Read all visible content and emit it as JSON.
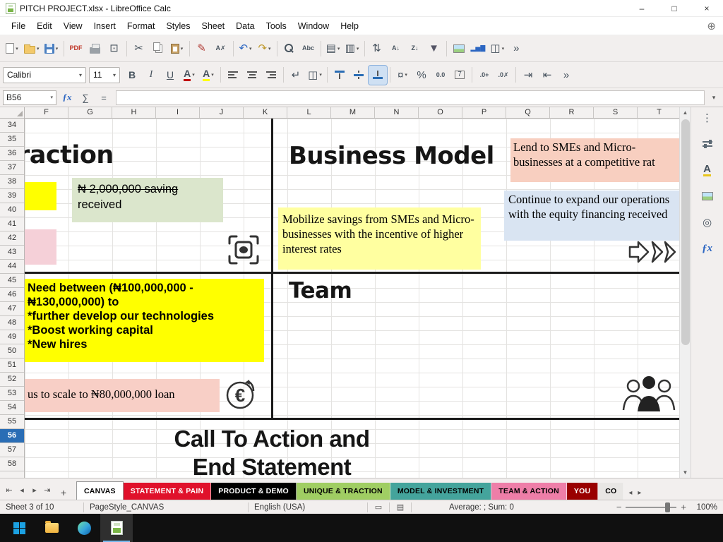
{
  "window": {
    "title": "PITCH PROJECT.xlsx - LibreOffice Calc",
    "minimize_glyph": "–",
    "maximize_glyph": "□",
    "close_glyph": "×"
  },
  "menu": {
    "items": [
      "File",
      "Edit",
      "View",
      "Insert",
      "Format",
      "Styles",
      "Sheet",
      "Data",
      "Tools",
      "Window",
      "Help"
    ],
    "right_icon_glyph": "⊕"
  },
  "toolbar_main": {
    "items": [
      {
        "name": "new-document",
        "icon": "doc",
        "dropdown": true
      },
      {
        "name": "open-file",
        "icon": "folder",
        "dropdown": true
      },
      {
        "name": "save",
        "icon": "save",
        "dropdown": true
      },
      {
        "sep": true
      },
      {
        "name": "export-pdf",
        "glyph": "PDF",
        "cls": "tiny red"
      },
      {
        "name": "print",
        "icon": "printer"
      },
      {
        "name": "print-preview",
        "glyph": "⊡"
      },
      {
        "sep": true
      },
      {
        "name": "cut",
        "glyph": "✂"
      },
      {
        "name": "copy",
        "icon": "copy"
      },
      {
        "name": "paste",
        "icon": "paste",
        "dropdown": true
      },
      {
        "sep": true
      },
      {
        "name": "clone-formatting",
        "glyph": "✎",
        "color": "#b3403a"
      },
      {
        "name": "clear-formatting",
        "glyph": "A✗",
        "cls": "tiny"
      },
      {
        "sep": true
      },
      {
        "name": "undo",
        "glyph": "↶",
        "color": "#2c66c2",
        "dropdown": true
      },
      {
        "name": "redo",
        "glyph": "↷",
        "color": "#c09a2f",
        "dropdown": true
      },
      {
        "sep": true
      },
      {
        "name": "find-and-replace",
        "icon": "magnifier"
      },
      {
        "name": "spelling",
        "glyph": "Abc",
        "cls": "tiny"
      },
      {
        "sep": true
      },
      {
        "name": "insert-rows",
        "glyph": "▤",
        "dropdown": true
      },
      {
        "name": "insert-columns",
        "glyph": "▥",
        "dropdown": true
      },
      {
        "sep": true
      },
      {
        "name": "sort",
        "glyph": "⇅"
      },
      {
        "name": "sort-ascending",
        "glyph": "A↓",
        "cls": "tiny"
      },
      {
        "name": "sort-descending",
        "glyph": "Z↓",
        "cls": "tiny"
      },
      {
        "name": "autofilter",
        "glyph": "▼",
        "color": "#556"
      },
      {
        "sep": true
      },
      {
        "name": "insert-image",
        "icon": "image"
      },
      {
        "name": "insert-chart",
        "glyph": "▂▅▇",
        "color": "#2c66c2",
        "cls": "tiny"
      },
      {
        "name": "freeze-rows-and-columns",
        "glyph": "◫",
        "dropdown": true
      },
      {
        "name": "toolbar-overflow",
        "glyph": "»"
      }
    ]
  },
  "toolbar_format": {
    "items": [
      {
        "name": "font-name-select",
        "combo": "Calibri",
        "w": 118
      },
      {
        "name": "font-size-select",
        "combo": "11",
        "w": 44
      },
      {
        "name": "bold",
        "glyph": "B",
        "cls": "b"
      },
      {
        "name": "italic",
        "glyph": "I",
        "cls": "i"
      },
      {
        "name": "underline",
        "glyph": "U",
        "cls": "u"
      },
      {
        "name": "font-color",
        "glyph": "A",
        "cls": "b",
        "bar": "#c00000",
        "dropdown": true
      },
      {
        "name": "highlighting-color",
        "glyph": "A",
        "cls": "b",
        "bar": "#ffff00",
        "dropdown": true
      },
      {
        "sep": true
      },
      {
        "name": "align-left",
        "icon": "bars-l"
      },
      {
        "name": "align-center",
        "icon": "bars-c"
      },
      {
        "name": "align-right",
        "icon": "bars-r"
      },
      {
        "sep": true
      },
      {
        "name": "wrap-text",
        "glyph": "↵"
      },
      {
        "name": "merge-cells",
        "glyph": "◫",
        "dropdown": true
      },
      {
        "sep": true
      },
      {
        "name": "align-top",
        "icon": "va-t"
      },
      {
        "name": "center-vertically",
        "icon": "va-c"
      },
      {
        "name": "align-bottom",
        "icon": "va-b",
        "active": true
      },
      {
        "sep": true
      },
      {
        "name": "format-as-currency",
        "glyph": "¤",
        "dropdown": true
      },
      {
        "name": "format-as-percent",
        "glyph": "%"
      },
      {
        "name": "format-as-number",
        "glyph": "0.0",
        "cls": "tiny"
      },
      {
        "name": "format-as-date",
        "glyph": "7",
        "cls": "boxed"
      },
      {
        "sep": true
      },
      {
        "name": "add-decimal-place",
        "glyph": ".0+",
        "cls": "tiny"
      },
      {
        "name": "delete-decimal-place",
        "glyph": ".0✗",
        "cls": "tiny"
      },
      {
        "sep": true
      },
      {
        "name": "increase-indent",
        "glyph": "⇥"
      },
      {
        "name": "decrease-indent",
        "glyph": "⇤"
      },
      {
        "name": "formatbar-overflow",
        "glyph": "»"
      }
    ]
  },
  "formula_bar": {
    "cell_reference": "B56",
    "function_wizard_glyph": "ƒx",
    "sum_glyph": "∑",
    "equals_glyph": "=",
    "formula_value": "",
    "expand_glyph": "▾"
  },
  "grid": {
    "columns": [
      "F",
      "G",
      "H",
      "I",
      "J",
      "K",
      "L",
      "M",
      "N",
      "O",
      "P",
      "Q",
      "R",
      "S",
      "T"
    ],
    "rows": [
      "34",
      "35",
      "36",
      "37",
      "38",
      "39",
      "40",
      "41",
      "42",
      "43",
      "44",
      "45",
      "46",
      "47",
      "48",
      "49",
      "50",
      "51",
      "52",
      "53",
      "54",
      "55",
      "56",
      "57",
      "58"
    ],
    "active_row": "56"
  },
  "canvas": {
    "traction_heading": "raction",
    "business_model_heading": "Business Model",
    "team_heading": "Team",
    "cta_line1": "Call To Action and",
    "cta_line2": "End Statement",
    "note_lend": "Lend to SMEs and Micro-businesses at a competitive rat",
    "note_saving_struck": "₦ 2,000,000 saving",
    "note_saving_rest": " received",
    "note_expand": "Continue to expand our operations with the equity financing received",
    "note_mobilize": "Mobilize savings from SMEs and Micro-businesses with the incentive of higher interest rates",
    "note_need": "Need between (₦100,000,000 -\n₦130,000,000) to\n*further develop our technologies\n*Boost working capital\n*New hires",
    "note_scale": "us to scale to ₦80,000,000 loan"
  },
  "tab_nav": {
    "first_glyph": "⇤",
    "prev_glyph": "◂",
    "next_glyph": "▸",
    "last_glyph": "⇥",
    "add_glyph": "+",
    "scroll_left_glyph": "◂",
    "scroll_right_glyph": "▸"
  },
  "sheet_tabs": [
    {
      "label": "CANVAS",
      "active": true,
      "bg": "#ffffff",
      "fg": "#000000"
    },
    {
      "label": "STATEMENT & PAIN",
      "bg": "#e0112b",
      "fg": "#ffffff"
    },
    {
      "label": "PRODUCT & DEMO",
      "bg": "#000000",
      "fg": "#ffffff"
    },
    {
      "label": "UNIQUE & TRACTION",
      "bg": "#a0ce63",
      "fg": "#000000"
    },
    {
      "label": "MODEL & INVESTMENT",
      "bg": "#44a49c",
      "fg": "#000000"
    },
    {
      "label": "TEAM & ACTION",
      "bg": "#ee7ea8",
      "fg": "#000000"
    },
    {
      "label": "YOU",
      "bg": "#990000",
      "fg": "#ffffff"
    },
    {
      "label": "CO",
      "bg": "#e8e6e4",
      "fg": "#000000"
    }
  ],
  "sidebar": {
    "icons": [
      {
        "name": "sidebar-settings",
        "glyph": "⋮"
      },
      {
        "name": "properties-deck",
        "icon": "sliders"
      },
      {
        "name": "styles-deck",
        "glyph": "A",
        "bar": "#e8c51c"
      },
      {
        "name": "gallery-deck",
        "icon": "image"
      },
      {
        "name": "navigator-deck",
        "glyph": "◎"
      },
      {
        "name": "functions-deck",
        "glyph": "ƒx",
        "cls": "fx"
      }
    ]
  },
  "scrollbar": {
    "up_glyph": "▲",
    "down_glyph": "▼"
  },
  "status_bar": {
    "sheet_info": "Sheet 3 of 10",
    "page_style": "PageStyle_CANVAS",
    "language": "English (USA)",
    "selection_mode_glyph": "▭",
    "modified_glyph": "▤",
    "stats": "Average: ; Sum: 0",
    "zoom_out_glyph": "−",
    "zoom_in_glyph": "+",
    "zoom_level": "100%"
  },
  "colors": {
    "accent_blue": "#2a6db5",
    "note_yellow": "#ffff00",
    "note_light_yellow": "#ffffa0",
    "note_green": "#dbe6cc",
    "note_blue": "#d9e4f2",
    "note_salmon": "#f8cfc0",
    "note_pink": "#f5d0d8"
  }
}
